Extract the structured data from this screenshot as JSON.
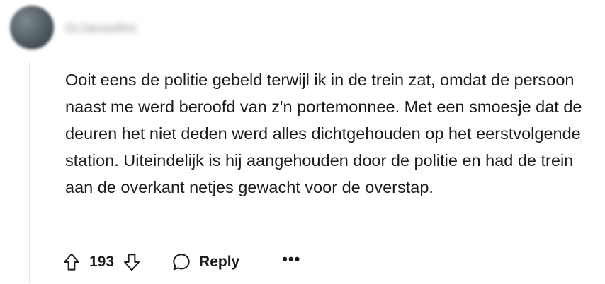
{
  "comment": {
    "username": "GrJansellmi",
    "body": "Ooit eens de politie gebeld terwijl ik in de trein zat, omdat de persoon naast me werd beroofd van z'n portemonnee. Met een smoesje dat de deuren het niet deden werd alles dichtgehouden op het eerstvolgende station. Uiteindelijk is hij aangehouden door de politie en had de trein aan de overkant netjes gewacht voor de overstap.",
    "score": "193",
    "reply_label": "Reply",
    "more_label": "•••"
  },
  "icons": {
    "upvote": "arrow-up-outline-icon",
    "downvote": "arrow-down-outline-icon",
    "reply": "speech-bubble-icon",
    "more": "ellipsis-icon"
  }
}
